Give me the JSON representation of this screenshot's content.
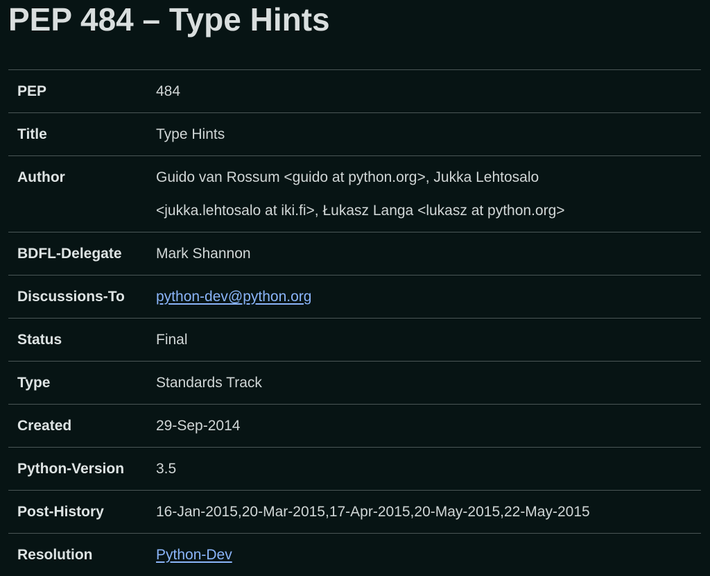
{
  "page": {
    "title": "PEP 484 – Type Hints"
  },
  "header_fields": {
    "pep": {
      "label": "PEP",
      "value": "484"
    },
    "title": {
      "label": "Title",
      "value": "Type Hints"
    },
    "author": {
      "label": "Author",
      "value_line1": "Guido van Rossum <guido at python.org>, Jukka Lehtosalo",
      "value_line2": "<jukka.lehtosalo at iki.fi>, Łukasz Langa <lukasz at python.org>"
    },
    "bdfl_delegate": {
      "label": "BDFL-Delegate",
      "value": "Mark Shannon"
    },
    "discussions_to": {
      "label": "Discussions-To",
      "value": "python-dev@python.org"
    },
    "status": {
      "label": "Status",
      "value": "Final"
    },
    "type": {
      "label": "Type",
      "value": "Standards Track"
    },
    "created": {
      "label": "Created",
      "value": "29-Sep-2014"
    },
    "python_version": {
      "label": "Python-Version",
      "value": "3.5"
    },
    "post_history": {
      "label": "Post-History",
      "value": "16-Jan-2015,20-Mar-2015,17-Apr-2015,20-May-2015,22-May-2015"
    },
    "resolution": {
      "label": "Resolution",
      "value": "Python-Dev"
    }
  },
  "colors": {
    "background": "#071414",
    "text": "#d6dcdc",
    "link": "#8ab4f8",
    "divider": "#4a5656"
  }
}
